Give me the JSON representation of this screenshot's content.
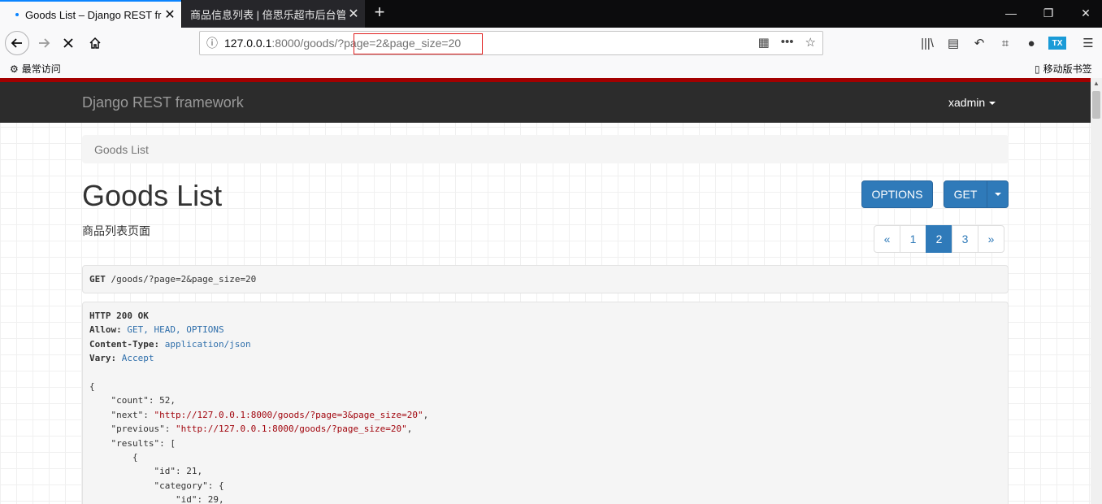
{
  "browser": {
    "tabs": [
      {
        "title": "Goods List – Django REST framework",
        "close": "✕"
      },
      {
        "title": "商品信息列表 | 倍思乐超市后台管理",
        "close": "✕"
      }
    ],
    "new_tab": "+",
    "window_controls": {
      "minimize": "—",
      "restore": "❐",
      "close": "✕"
    },
    "url": {
      "host": "127.0.0.1",
      "port_path": ":8000/goods/?",
      "query": "page=2&page_size=20"
    },
    "bookmarks": {
      "left_label": "最常访问",
      "right_label": "移动版书签"
    }
  },
  "drf": {
    "brand": "Django REST framework",
    "user": "xadmin",
    "breadcrumb": "Goods List",
    "title": "Goods List",
    "description": "商品列表页面",
    "buttons": {
      "options": "OPTIONS",
      "get": "GET"
    },
    "pagination": {
      "prev": "«",
      "pages": [
        "1",
        "2",
        "3"
      ],
      "current": "2",
      "next": "»"
    },
    "request": {
      "method": "GET",
      "path": " /goods/?page=2&page_size=20"
    },
    "response": {
      "status": "HTTP 200 OK",
      "allow_key": "Allow:",
      "allow_val": " GET, HEAD, OPTIONS",
      "ctype_key": "Content-Type:",
      "ctype_val": " application/json",
      "vary_key": "Vary:",
      "vary_val": " Accept",
      "open_brace": "{",
      "count_line": "    \"count\": 52,",
      "next_key": "    \"next\": ",
      "next_val": "\"http://127.0.0.1:8000/goods/?page=3&page_size=20\"",
      "prev_key": "    \"previous\": ",
      "prev_val": "\"http://127.0.0.1:8000/goods/?page_size=20\"",
      "results_line": "    \"results\": [",
      "obj_open": "        {",
      "id_line": "            \"id\": 21,",
      "category_line": "            \"category\": {",
      "cat_id_line": "                \"id\": 29,"
    }
  }
}
